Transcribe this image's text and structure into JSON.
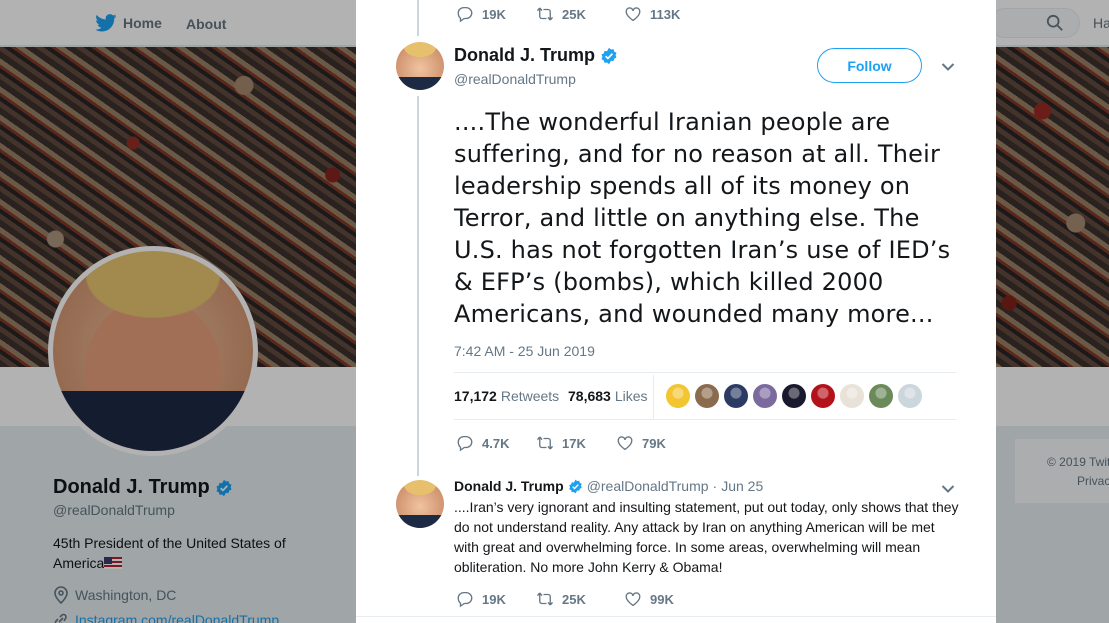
{
  "background": {
    "nav": {
      "home": "Home",
      "about": "About",
      "right_cut": "Ha"
    },
    "profile": {
      "name": "Donald J. Trump",
      "handle": "@realDonaldTrump",
      "bio": "45th President of the United States of America",
      "location": "Washington, DC",
      "link": "Instagram.com/realDonaldTrump"
    },
    "footer": {
      "copyright": "© 2019 Twit",
      "privacy": "Privac"
    }
  },
  "previous_tweet": {
    "replies": "19K",
    "retweets": "25K",
    "likes": "113K"
  },
  "tweet": {
    "author_name": "Donald J. Trump",
    "author_handle": "@realDonaldTrump",
    "follow_label": "Follow",
    "text": "....The wonderful Iranian people are suffering, and for no reason at all. Their leadership spends all of its money on Terror, and little on anything else. The U.S. has not forgotten Iran’s use of IED’s & EFP’s (bombs), which killed 2000 Americans, and wounded many more...",
    "timestamp": "7:42 AM - 25 Jun 2019",
    "retweet_count": "17,172",
    "retweet_label": "Retweets",
    "like_count": "78,683",
    "like_label": "Likes",
    "liker_colors": [
      "#f2c531",
      "#8a6b4e",
      "#2b3b63",
      "#7b6a9e",
      "#1a1a2e",
      "#b3121b",
      "#e9e2d8",
      "#6b8a5a",
      "#ccd6dd"
    ],
    "actions": {
      "replies": "4.7K",
      "retweets": "17K",
      "likes": "79K"
    }
  },
  "reply": {
    "author_name": "Donald J. Trump",
    "author_handle": "@realDonaldTrump",
    "date": "Jun 25",
    "text": "....Iran’s very ignorant and insulting statement, put out today, only shows that they do not understand reality. Any attack by Iran on anything American will be met with great and overwhelming force. In some areas, overwhelming will mean obliteration. No more John Kerry & Obama!",
    "actions": {
      "replies": "19K",
      "retweets": "25K",
      "likes": "99K"
    }
  },
  "colors": {
    "accent": "#1da1f2",
    "muted": "#657786",
    "text": "#14171a"
  }
}
